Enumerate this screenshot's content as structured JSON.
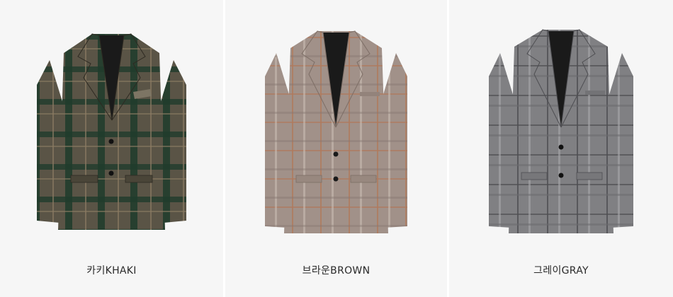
{
  "products": [
    {
      "color_label": "카키KHAKI",
      "swatch": "#4b4a3b",
      "check": "#1f3b2c",
      "accent": "#8a7b63"
    },
    {
      "color_label": "브라운BROWN",
      "swatch": "#9a8a82",
      "check": "#b07a5d",
      "accent": "#c9bcb2"
    },
    {
      "color_label": "그레이GRAY",
      "swatch": "#7d7d7f",
      "check": "#4e4e52",
      "accent": "#a9a9ab"
    }
  ]
}
